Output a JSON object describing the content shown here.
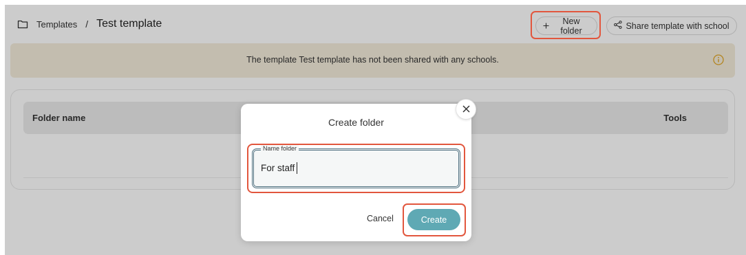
{
  "breadcrumb": {
    "root": "Templates",
    "separator": "/",
    "current": "Test template"
  },
  "header": {
    "new_folder_label": "New folder",
    "share_label": "Share template with school"
  },
  "notice": {
    "text": "The template Test template has not been shared with any schools."
  },
  "table": {
    "columns": [
      "Folder name",
      "Tools"
    ]
  },
  "modal": {
    "title": "Create folder",
    "field_label": "Name folder",
    "field_value": "For staff",
    "cancel_label": "Cancel",
    "create_label": "Create"
  },
  "colors": {
    "accent": "#5fa9b4",
    "highlight": "#e2563d",
    "notice_bg": "#f4eddb",
    "info_icon": "#e0a526"
  },
  "icons": {
    "breadcrumb": "folder-icon",
    "new_folder": "plus-icon",
    "share": "share-icon",
    "notice": "info-icon",
    "close": "close-icon"
  }
}
